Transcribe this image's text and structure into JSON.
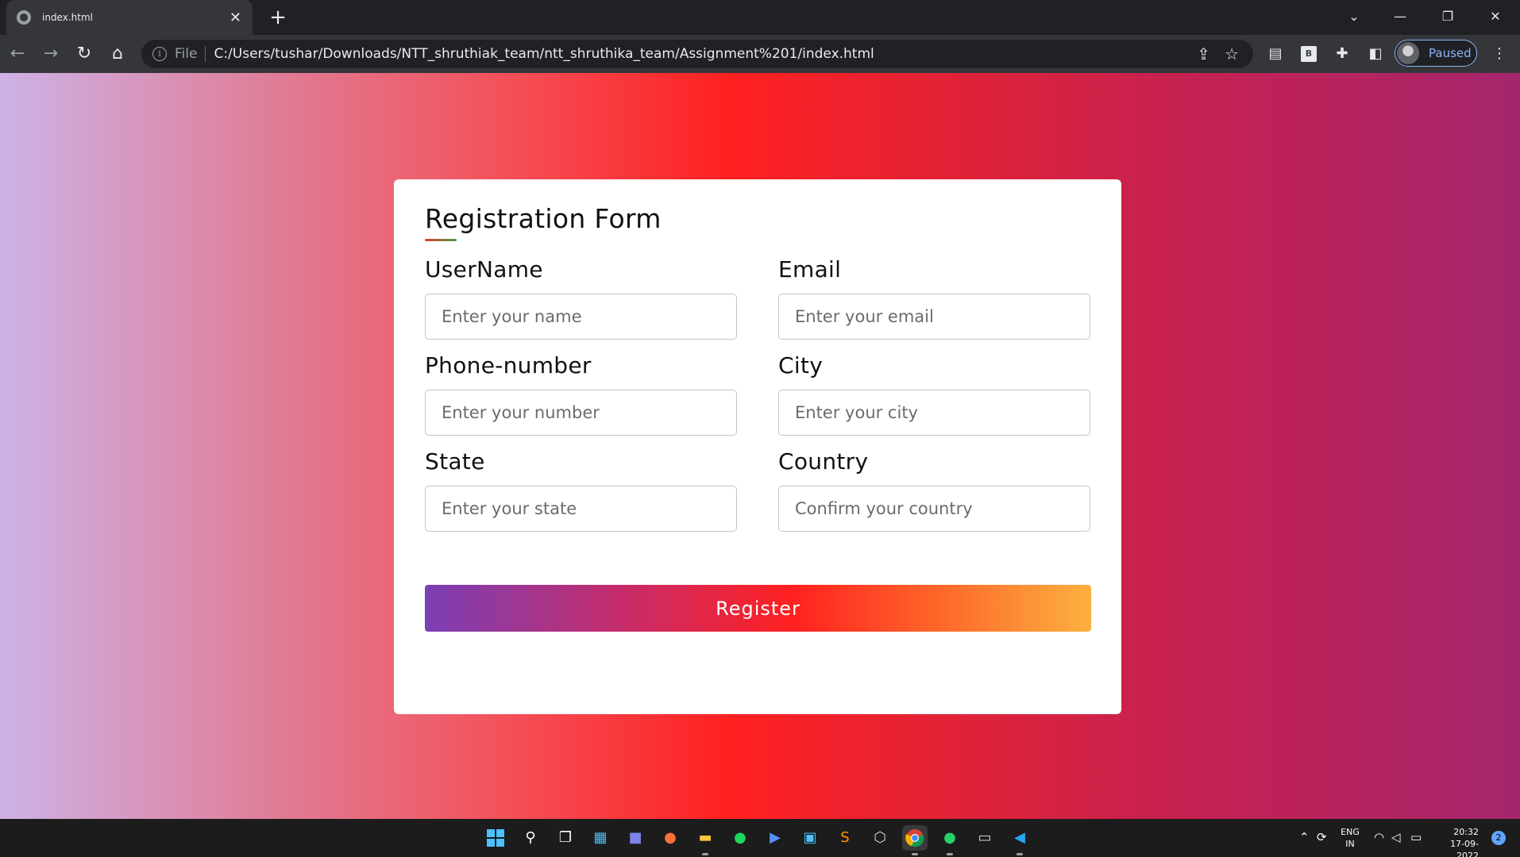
{
  "browser": {
    "tab_title": "index.html",
    "tab_close_glyph": "✕",
    "new_tab_glyph": "+",
    "scheme_label": "File",
    "url": "C:/Users/tushar/Downloads/NTT_shruthiak_team/ntt_shruthika_team/Assignment%201/index.html",
    "profile_status": "Paused",
    "extension_b_label": "B",
    "window_controls": {
      "tab_search": "⌄",
      "minimize": "—",
      "restore": "❐",
      "close": "✕"
    },
    "nav": {
      "back": "←",
      "forward": "→",
      "reload": "↻",
      "home": "⌂"
    }
  },
  "form": {
    "title": "Registration Form",
    "fields": {
      "username": {
        "label": "UserName",
        "placeholder": "Enter your name",
        "value": ""
      },
      "email": {
        "label": "Email",
        "placeholder": "Enter your email",
        "value": ""
      },
      "phone": {
        "label": "Phone-number",
        "placeholder": "Enter your number",
        "value": ""
      },
      "city": {
        "label": "City",
        "placeholder": "Enter your city",
        "value": ""
      },
      "state": {
        "label": "State",
        "placeholder": "Enter your state",
        "value": ""
      },
      "country": {
        "label": "Country",
        "placeholder": "Confirm your country",
        "value": ""
      }
    },
    "submit_label": "Register"
  },
  "taskbar": {
    "apps": [
      "windows-start-icon",
      "search-icon",
      "task-view-icon",
      "widgets-icon",
      "teams-chat-icon",
      "firefox-icon",
      "file-explorer-icon",
      "spotify-icon",
      "powershell-icon",
      "microsoft-store-icon",
      "sublime-text-icon",
      "virtualbox-icon",
      "chrome-icon",
      "whatsapp-icon",
      "terminal-icon",
      "vscode-icon"
    ],
    "language": "ENG",
    "region": "IN",
    "time": "20:32",
    "date": "17-09-2022",
    "notification_count": "2"
  },
  "colors": {
    "page_gradient": [
      "#cdb2e6",
      "#ff2020",
      "#a5266d"
    ],
    "button_gradient": [
      "#7b3fb5",
      "#ff2020",
      "#fbb040"
    ],
    "browser_dark": "#202124",
    "profile_accent": "#8ab4f8"
  }
}
